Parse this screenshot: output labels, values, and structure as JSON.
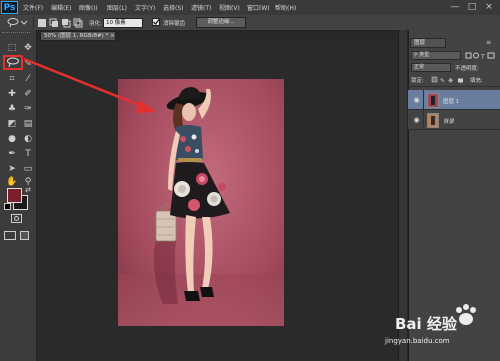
{
  "app": {
    "logo": "Ps"
  },
  "menubar": {
    "items": [
      "文件(F)",
      "编辑(E)",
      "图像(I)",
      "图层(L)",
      "文字(Y)",
      "选择(S)",
      "滤镜(T)",
      "视图(V)",
      "窗口(W)",
      "帮助(H)"
    ],
    "minimize": "—",
    "maximize": "□",
    "close": "×"
  },
  "options": {
    "feather_label": "羽化:",
    "feather_value": "10 像素",
    "antialias_label": "消除锯齿",
    "refine_edge_label": "调整边缘..."
  },
  "document": {
    "tab_label": "50% (图层 1, RGB/8#) *",
    "tab_close": "×"
  },
  "colors": {
    "foreground": "#7b1f2c",
    "background": "#1a1a1a",
    "highlight": "#e53030"
  },
  "layers_panel": {
    "tab_label": "图层",
    "filter_label": "类型",
    "blend_mode": "正常",
    "opacity_label": "不透明度:",
    "lock_label": "锁定:",
    "fill_label": "填充:",
    "layers": [
      {
        "name": "图层 1",
        "selected": true
      },
      {
        "name": "背景",
        "selected": false
      }
    ]
  },
  "watermark": {
    "brand": "Bai 经验",
    "url": "jingyan.baidu.com"
  }
}
